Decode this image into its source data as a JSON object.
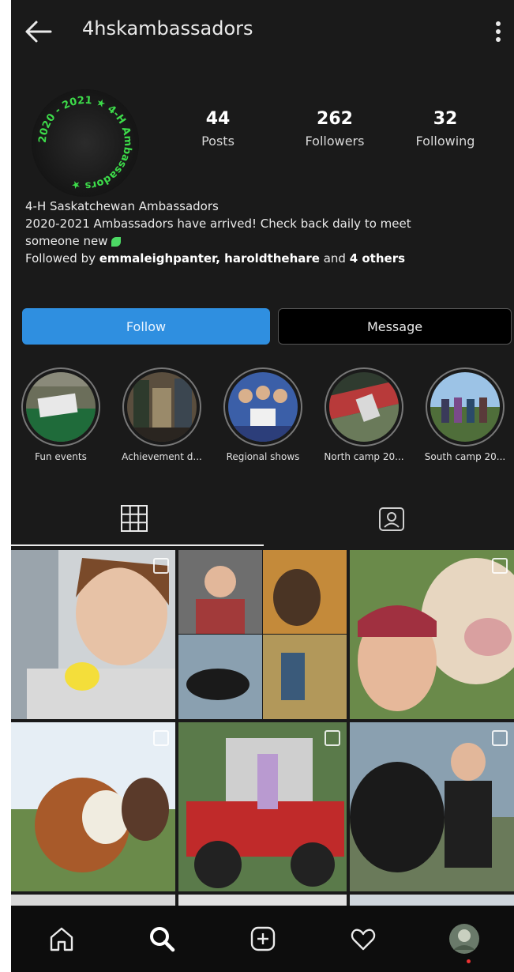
{
  "header": {
    "username": "4hskambassadors"
  },
  "profile": {
    "avatar_ring_text": "2020 - 2021 ★ 4-H Ambassadors ★",
    "stats": [
      {
        "value": "44",
        "label": "Posts"
      },
      {
        "value": "262",
        "label": "Followers"
      },
      {
        "value": "32",
        "label": "Following"
      }
    ]
  },
  "bio": {
    "name": "4-H Saskatchewan Ambassadors",
    "line1": "2020-2021 Ambassadors have arrived! Check back daily to meet",
    "line2": "someone new",
    "followed_prefix": "Followed by ",
    "followed_names": "emmaleighpanter, haroldthehare",
    "followed_and": " and ",
    "followed_others": "4 others"
  },
  "actions": {
    "follow_label": "Follow",
    "message_label": "Message"
  },
  "highlights": [
    {
      "label": "Fun events"
    },
    {
      "label": "Achievement d..."
    },
    {
      "label": "Regional shows"
    },
    {
      "label": "North camp 20..."
    },
    {
      "label": "South camp 20..."
    }
  ],
  "colors": {
    "background": "#1a1a1a",
    "follow_button": "#2f8fe0",
    "avatar_text": "#3ddc4a",
    "accent_dot": "#e33333"
  }
}
